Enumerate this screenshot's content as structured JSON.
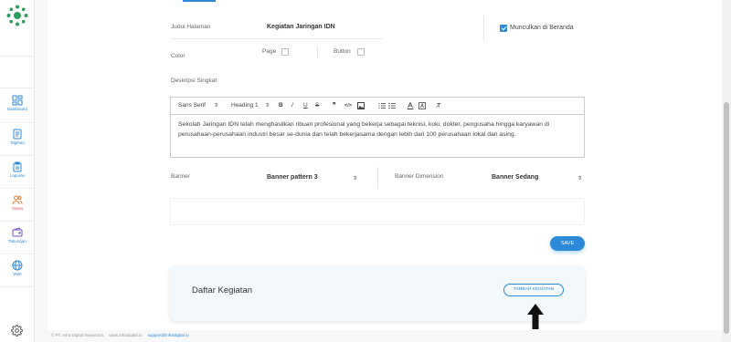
{
  "sidebar": {
    "items": [
      {
        "label": "Dashboard",
        "icon": "dashboard-icon"
      },
      {
        "label": "Tagihan",
        "icon": "document-icon"
      },
      {
        "label": "Laporan",
        "icon": "clipboard-icon"
      },
      {
        "label": "Siswa",
        "icon": "users-icon"
      },
      {
        "label": "Tabungan",
        "icon": "wallet-icon"
      },
      {
        "label": "Web",
        "icon": "globe-icon"
      }
    ],
    "settings_icon": "gear-icon"
  },
  "form": {
    "judul_label": "Judul Halaman",
    "judul_value": "Kegiatan Jaringan IDN",
    "beranda_label": "Munculkan di Beranda",
    "beranda_checked": true,
    "color_label": "Color",
    "page_label": "Page",
    "button_label": "Button",
    "deskripsi_label": "Deskripsi Singkat",
    "banner_label": "Banner",
    "banner_value": "Banner pattern 3",
    "dimension_label": "Banner Dimension",
    "dimension_value": "Banner Sedang",
    "save_label": "SAVE"
  },
  "editor": {
    "font": "Sans Serif",
    "heading": "Heading 1",
    "bold": "B",
    "italic": "I",
    "underline": "U",
    "strike": "S",
    "quote": "❞",
    "code": "</>",
    "text": "Sekolah Jaringan IDN telah menghasilkan ribuan profesional yang bekerja sebagai teknisi, koki, dokter, pengusaha hingga karyawan di perusahaan-perusahaan industri besar se-dunia dan telah bekerjasama dengan lebih dari 100 perusahaan lokal dan asing."
  },
  "daftar": {
    "title": "Daftar Kegiatan",
    "button": "TAMBAH KEGIATAN"
  },
  "footer": {
    "company": "© PT. Infra Digital Nusantara",
    "website": "www.infradigital.io",
    "email": "support@infradigital.io"
  },
  "colors": {
    "accent": "#2c8ad9",
    "logo": "#2e9e5b"
  }
}
